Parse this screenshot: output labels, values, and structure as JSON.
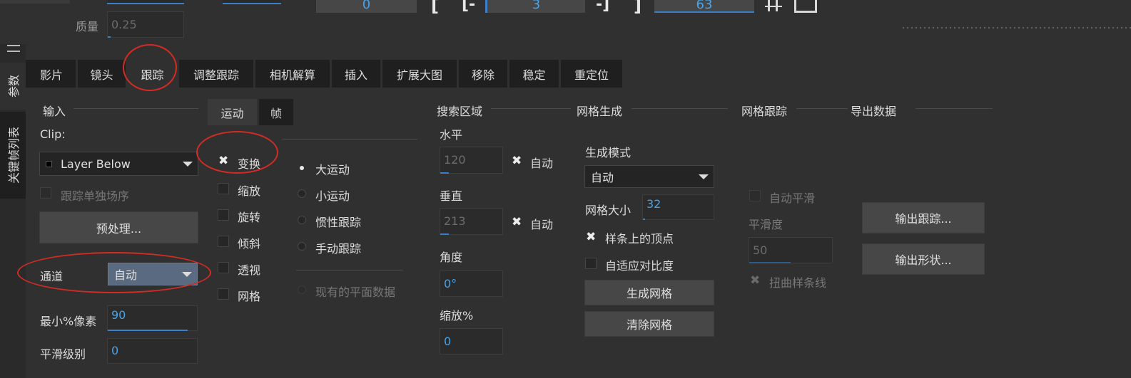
{
  "top": {
    "quality_label": "质量",
    "quality_value": "0.25",
    "frame_start": "0",
    "bracket_open": "[",
    "bracket_open_dash": "[-",
    "frame_mid": "3",
    "bracket_close_dash": "-]",
    "bracket_close": "]",
    "frame_end": "63"
  },
  "side_tabs": {
    "params": "参数",
    "keyframe_list": "关键帧列表"
  },
  "main_tabs": [
    "影片",
    "镜头",
    "跟踪",
    "调整跟踪",
    "相机解算",
    "插入",
    "扩展大图",
    "移除",
    "稳定",
    "重定位"
  ],
  "input": {
    "heading": "输入",
    "clip_label": "Clip:",
    "clip_value": "Layer Below",
    "track_fields_label": "跟踪单独场序",
    "preprocess_button": "预处理...",
    "channel_label": "通道",
    "channel_value": "自动",
    "min_pixel_label": "最小%像素",
    "min_pixel_value": "90",
    "smooth_level_label": "平滑级别",
    "smooth_level_value": "0"
  },
  "motion": {
    "tabs": [
      "运动",
      "帧"
    ],
    "checks": [
      {
        "label": "变换",
        "checked": true
      },
      {
        "label": "缩放",
        "checked": false
      },
      {
        "label": "旋转",
        "checked": false
      },
      {
        "label": "倾斜",
        "checked": false
      },
      {
        "label": "透视",
        "checked": false
      },
      {
        "label": "网格",
        "checked": false
      }
    ],
    "radios": [
      {
        "label": "大运动",
        "selected": true
      },
      {
        "label": "小运动",
        "selected": false
      },
      {
        "label": "惯性跟踪",
        "selected": false
      },
      {
        "label": "手动跟踪",
        "selected": false
      }
    ],
    "existing_plane": "现有的平面数据"
  },
  "search": {
    "heading": "搜索区域",
    "horizontal_label": "水平",
    "horizontal_value": "120",
    "auto1": "自动",
    "vertical_label": "垂直",
    "vertical_value": "213",
    "auto2": "自动",
    "angle_label": "角度",
    "angle_value": "0°",
    "scale_label": "缩放%",
    "scale_value": "0"
  },
  "mesh_gen": {
    "heading": "网格生成",
    "mode_label": "生成模式",
    "mode_value": "自动",
    "size_label": "网格大小",
    "size_value": "32",
    "vertices_label": "样条上的顶点",
    "adaptive_label": "自适应对比度",
    "generate_button": "生成网格",
    "clear_button": "清除网格"
  },
  "mesh_track": {
    "heading": "网格跟踪",
    "auto_smooth": "自动平滑",
    "smoothness_label": "平滑度",
    "smoothness_value": "50",
    "distort_label": "扭曲样条线"
  },
  "export": {
    "heading": "导出数据",
    "export_track_button": "输出跟踪...",
    "export_shape_button": "输出形状..."
  },
  "colors": {
    "accent": "#3a7fc8",
    "annotation": "#d22c24",
    "background": "#303030"
  }
}
